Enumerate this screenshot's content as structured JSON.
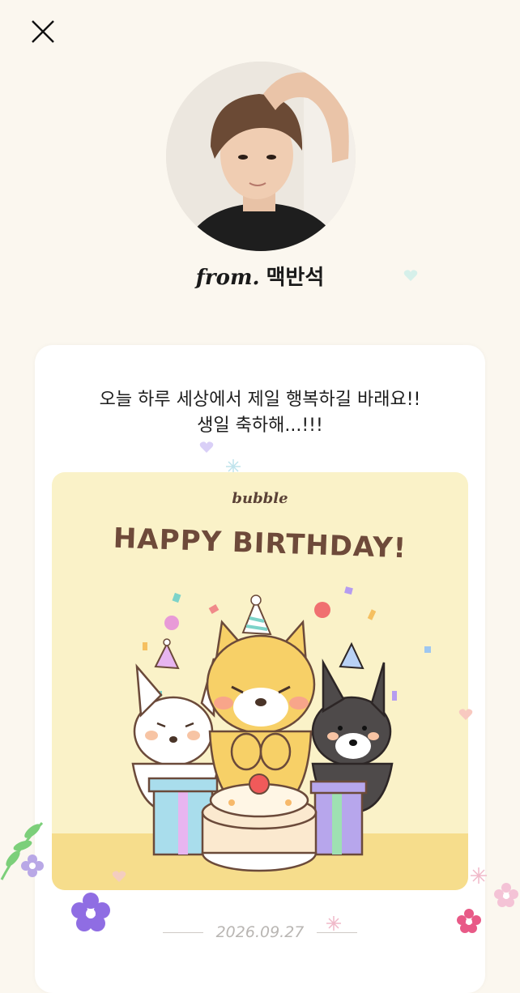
{
  "header": {
    "close_icon": "close-icon"
  },
  "profile": {
    "from_prefix": "from.",
    "sender_name": "맥반석"
  },
  "letter": {
    "message_line1": "오늘 하루 세상에서 제일 행복하길 바래요!!",
    "message_line2": "생일 축하해...!!!"
  },
  "birthday_card": {
    "brand": "bubble",
    "title": "HAPPY BIRTHDAY!",
    "colors": {
      "panel": "#faf2c8",
      "title": "#6e4a3a",
      "floor": "#f6dd8c"
    }
  },
  "footer": {
    "date": "2026.09.27"
  }
}
